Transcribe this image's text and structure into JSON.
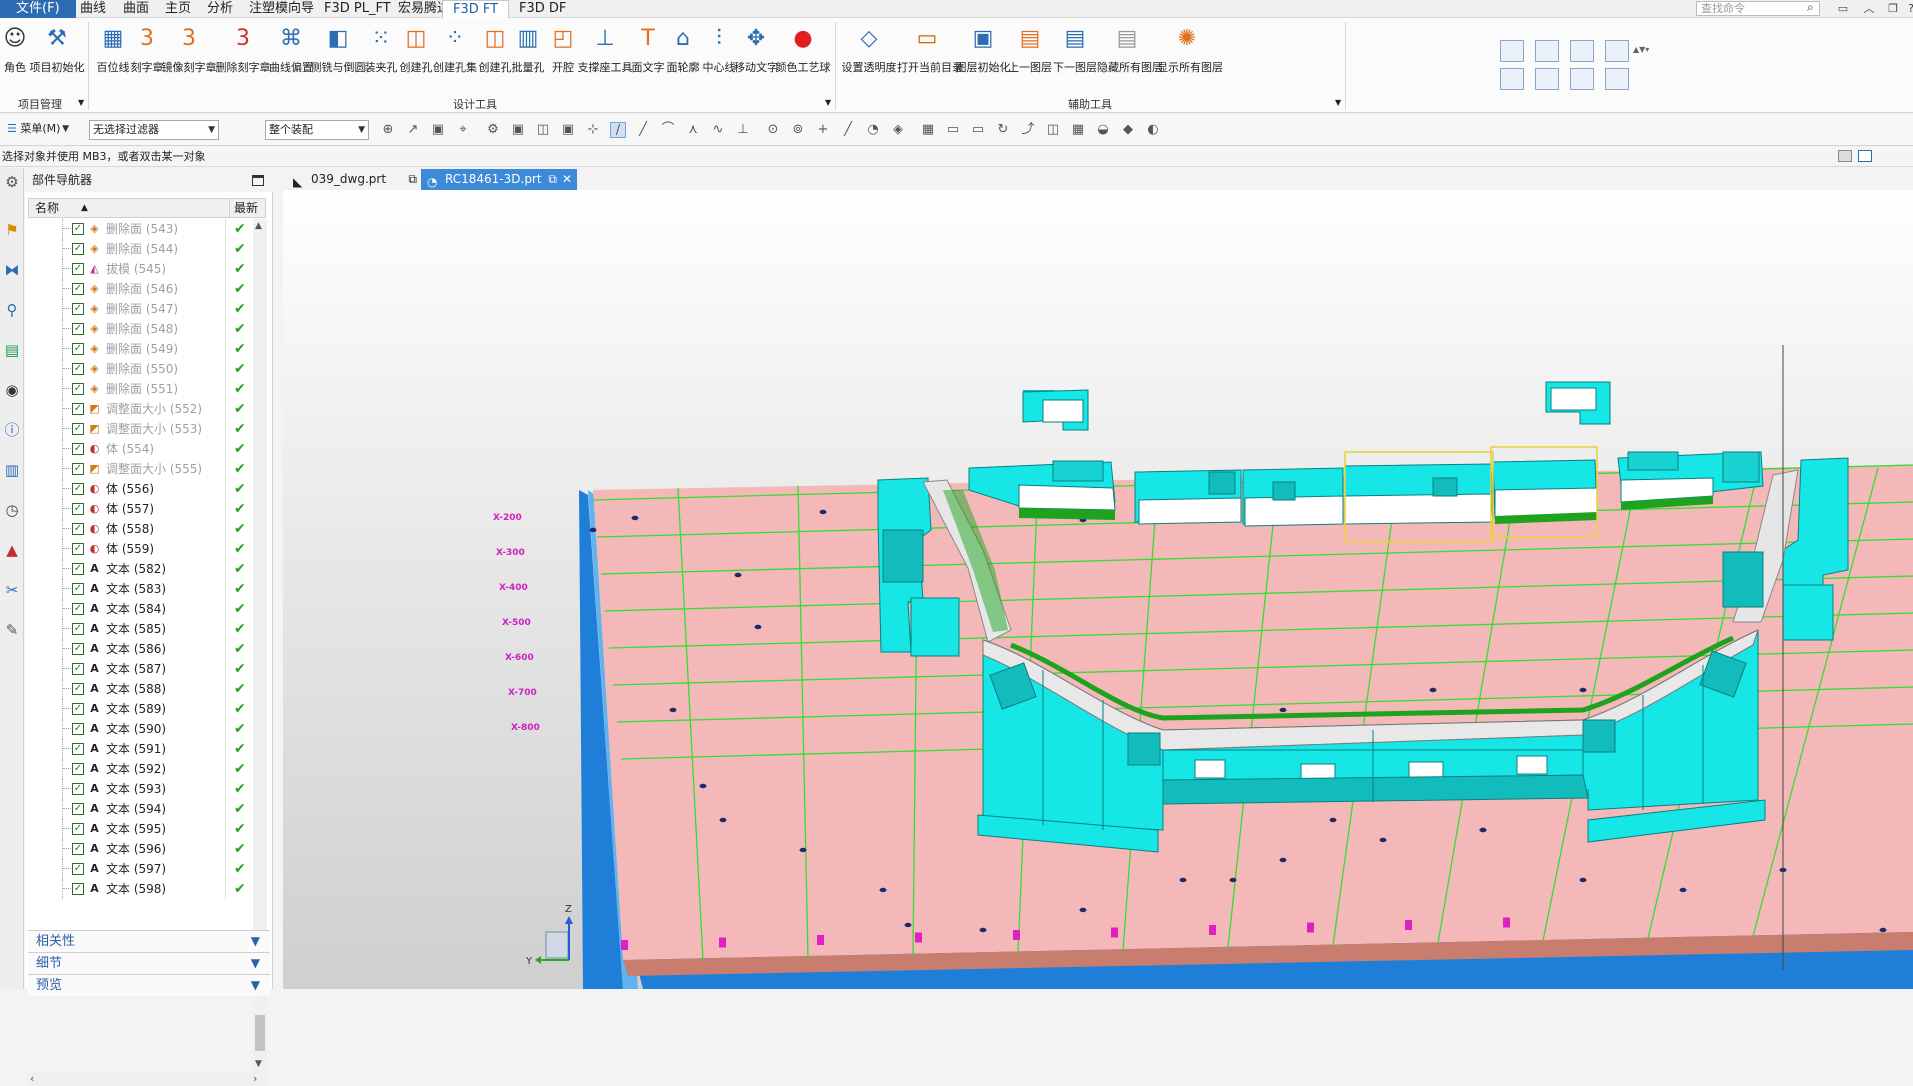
{
  "menubar": {
    "file": "文件(F)",
    "tabs": [
      "曲线",
      "曲面",
      "主页",
      "分析",
      "注塑模向导",
      "F3D PL_FT",
      "宏易腾达",
      "F3D FT",
      "F3D DF"
    ],
    "active_tab": "F3D FT",
    "search_placeholder": "查找命令"
  },
  "ribbon": {
    "groups": [
      {
        "label": "项目管理",
        "buttons": [
          "角色",
          "项目初始化"
        ]
      },
      {
        "label": "设计工具",
        "buttons": [
          "百位线",
          "刻字章",
          "镜像刻字章",
          "删除刻字章",
          "曲线偏置",
          "侧铣与倒圆",
          "装夹孔",
          "创建孔",
          "创建孔集",
          "创建孔",
          "批量孔",
          "开腔",
          "支撑座工具",
          "面文字",
          "面轮廓",
          "中心线",
          "移动文字",
          "颜色工艺球"
        ]
      },
      {
        "label": "辅助工具",
        "buttons": [
          "设置透明度",
          "打开当前目录",
          "图层初始化",
          "上一图层",
          "下一图层",
          "隐藏所有图层",
          "显示所有图层"
        ]
      }
    ]
  },
  "toolbar2": {
    "menu_label": "菜单(M)",
    "filter_value": "无选择过滤器",
    "assembly_value": "整个装配"
  },
  "status_text": "选择对象并使用 MB3，或者双击某一对象",
  "navigator": {
    "title": "部件导航器",
    "col_name": "名称",
    "col_latest": "最新",
    "rows": [
      {
        "label": "删除面 (543)",
        "type": "delete",
        "dim": true
      },
      {
        "label": "删除面 (544)",
        "type": "delete",
        "dim": true
      },
      {
        "label": "拔模 (545)",
        "type": "draft",
        "dim": true
      },
      {
        "label": "删除面 (546)",
        "type": "delete",
        "dim": true
      },
      {
        "label": "删除面 (547)",
        "type": "delete",
        "dim": true
      },
      {
        "label": "删除面 (548)",
        "type": "delete",
        "dim": true
      },
      {
        "label": "删除面 (549)",
        "type": "delete",
        "dim": true
      },
      {
        "label": "删除面 (550)",
        "type": "delete",
        "dim": true
      },
      {
        "label": "删除面 (551)",
        "type": "delete",
        "dim": true
      },
      {
        "label": "调整面大小 (552)",
        "type": "resize",
        "dim": true
      },
      {
        "label": "调整面大小 (553)",
        "type": "resize",
        "dim": true
      },
      {
        "label": "体 (554)",
        "type": "body",
        "dim": true
      },
      {
        "label": "调整面大小 (555)",
        "type": "resize",
        "dim": true
      },
      {
        "label": "体 (556)",
        "type": "body",
        "dim": false
      },
      {
        "label": "体 (557)",
        "type": "body",
        "dim": false
      },
      {
        "label": "体 (558)",
        "type": "body",
        "dim": false
      },
      {
        "label": "体 (559)",
        "type": "body",
        "dim": false
      },
      {
        "label": "文本 (582)",
        "type": "text",
        "dim": false
      },
      {
        "label": "文本 (583)",
        "type": "text",
        "dim": false
      },
      {
        "label": "文本 (584)",
        "type": "text",
        "dim": false
      },
      {
        "label": "文本 (585)",
        "type": "text",
        "dim": false
      },
      {
        "label": "文本 (586)",
        "type": "text",
        "dim": false
      },
      {
        "label": "文本 (587)",
        "type": "text",
        "dim": false
      },
      {
        "label": "文本 (588)",
        "type": "text",
        "dim": false
      },
      {
        "label": "文本 (589)",
        "type": "text",
        "dim": false
      },
      {
        "label": "文本 (590)",
        "type": "text",
        "dim": false
      },
      {
        "label": "文本 (591)",
        "type": "text",
        "dim": false
      },
      {
        "label": "文本 (592)",
        "type": "text",
        "dim": false
      },
      {
        "label": "文本 (593)",
        "type": "text",
        "dim": false
      },
      {
        "label": "文本 (594)",
        "type": "text",
        "dim": false
      },
      {
        "label": "文本 (595)",
        "type": "text",
        "dim": false
      },
      {
        "label": "文本 (596)",
        "type": "text",
        "dim": false
      },
      {
        "label": "文本 (597)",
        "type": "text",
        "dim": false
      },
      {
        "label": "文本 (598)",
        "type": "text",
        "dim": false
      }
    ],
    "sections": [
      "相关性",
      "细节",
      "预览"
    ]
  },
  "doc_tabs": [
    {
      "label": "039_dwg.prt",
      "active": false
    },
    {
      "label": "RC18461-3D.prt",
      "active": true
    }
  ],
  "viewport": {
    "grid_labels": [
      "X-200",
      "X-300",
      "X-400",
      "X-500",
      "X-600",
      "X-700",
      "X-800"
    ],
    "triad": {
      "z": "Z",
      "y": "Y"
    },
    "colors": {
      "base": "#f4b8b8",
      "grid": "#33dd33",
      "fixture": "#17e6e6",
      "strip": "#1fa31f",
      "frame": "#1f7fd8",
      "selection": "#e6d23a"
    }
  }
}
